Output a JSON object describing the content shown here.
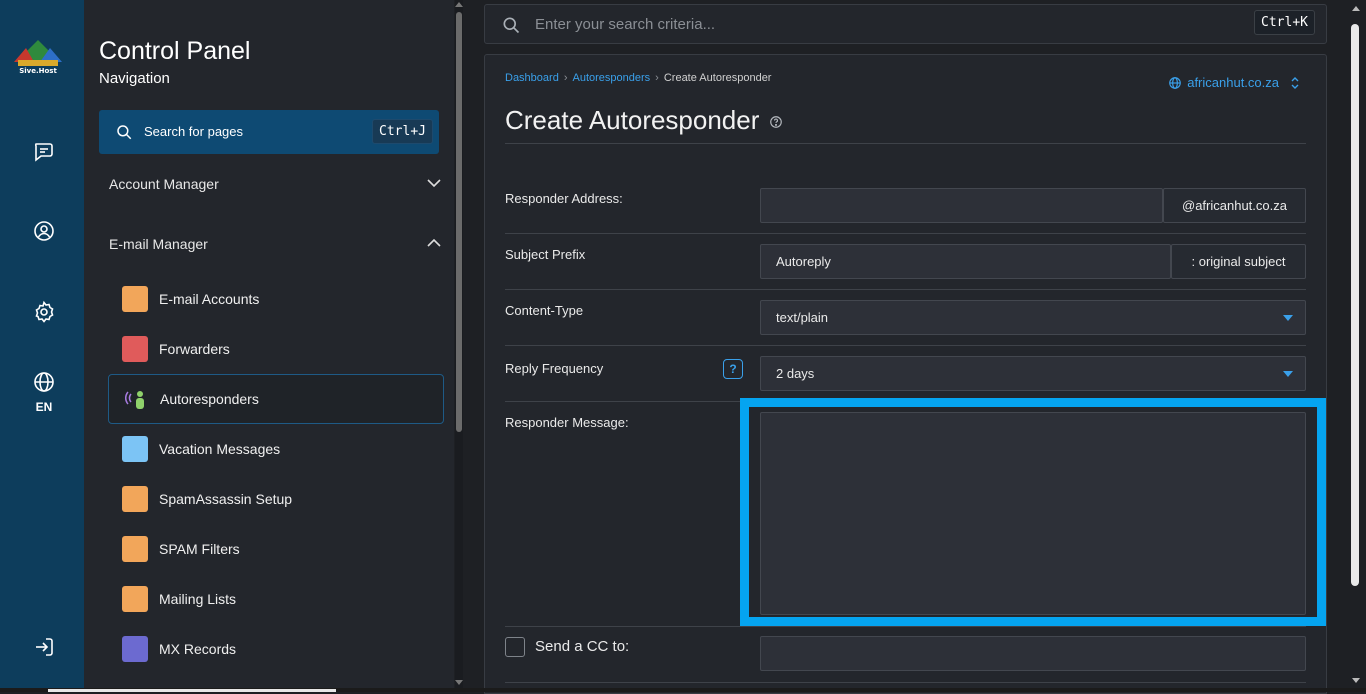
{
  "rail": {
    "logo_text": "Sive.Host",
    "icons": [
      "chat-icon",
      "user-circle-icon",
      "gear-icon",
      "globe-icon",
      "logout-icon"
    ],
    "language": "EN"
  },
  "nav": {
    "title": "Control Panel",
    "subtitle": "Navigation",
    "search_label": "Search for pages",
    "search_shortcut": "Ctrl+J",
    "sections": [
      {
        "label": "Account Manager",
        "expanded": false
      },
      {
        "label": "E-mail Manager",
        "expanded": true
      }
    ],
    "items": [
      {
        "label": "E-mail Accounts",
        "icon": "email-accounts-icon"
      },
      {
        "label": "Forwarders",
        "icon": "forwarders-icon"
      },
      {
        "label": "Autoresponders",
        "icon": "autoresponders-icon",
        "active": true
      },
      {
        "label": "Vacation Messages",
        "icon": "vacation-messages-icon"
      },
      {
        "label": "SpamAssassin Setup",
        "icon": "spamassassin-icon"
      },
      {
        "label": "SPAM Filters",
        "icon": "spam-filters-icon"
      },
      {
        "label": "Mailing Lists",
        "icon": "mailing-lists-icon"
      },
      {
        "label": "MX Records",
        "icon": "mx-records-icon"
      }
    ]
  },
  "topsearch": {
    "placeholder": "Enter your search criteria...",
    "shortcut": "Ctrl+K"
  },
  "breadcrumb": {
    "items": [
      "Dashboard",
      "Autoresponders",
      "Create Autoresponder"
    ]
  },
  "domain_selector": "africanhut.co.za",
  "page": {
    "title": "Create Autoresponder",
    "fields": {
      "responder_address": {
        "label": "Responder Address:",
        "value": "",
        "suffix": "@africanhut.co.za"
      },
      "subject_prefix": {
        "label": "Subject Prefix",
        "value": "Autoreply",
        "suffix": ": original subject"
      },
      "content_type": {
        "label": "Content-Type",
        "value": "text/plain"
      },
      "reply_frequency": {
        "label": "Reply Frequency",
        "value": "2 days",
        "help": "?"
      },
      "responder_message": {
        "label": "Responder Message:",
        "value": ""
      },
      "send_cc": {
        "label": "Send a CC to:",
        "checked": false,
        "value": ""
      }
    }
  },
  "colors": {
    "rail": "#0d3d5c",
    "accent": "#3aa0ea",
    "highlight": "#05a4f0"
  }
}
